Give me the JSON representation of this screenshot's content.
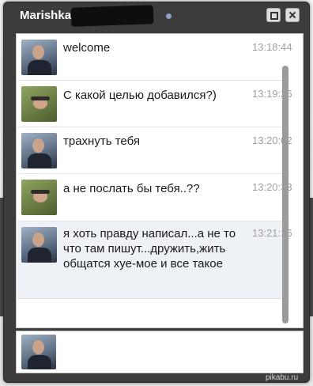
{
  "window": {
    "title": "Marishka"
  },
  "messages": [
    {
      "text": "welcome",
      "time": "13:18:44",
      "avatar": "male-avatar"
    },
    {
      "text": "С какой целью добавился?)",
      "time": "13:19:26",
      "avatar": "female-avatar"
    },
    {
      "text": "трахнуть тебя",
      "time": "13:20:02",
      "avatar": "male-avatar"
    },
    {
      "text": "а не послать бы тебя..??",
      "time": "13:20:33",
      "avatar": "female-avatar"
    },
    {
      "text": "я хоть правду написал...а не то что там пишут...дружить,жить общатся хуе-мое и все такое",
      "time": "13:21:16",
      "avatar": "male-avatar"
    }
  ],
  "compose": {
    "value": "",
    "placeholder": ""
  },
  "watermark": "pikabu.ru"
}
